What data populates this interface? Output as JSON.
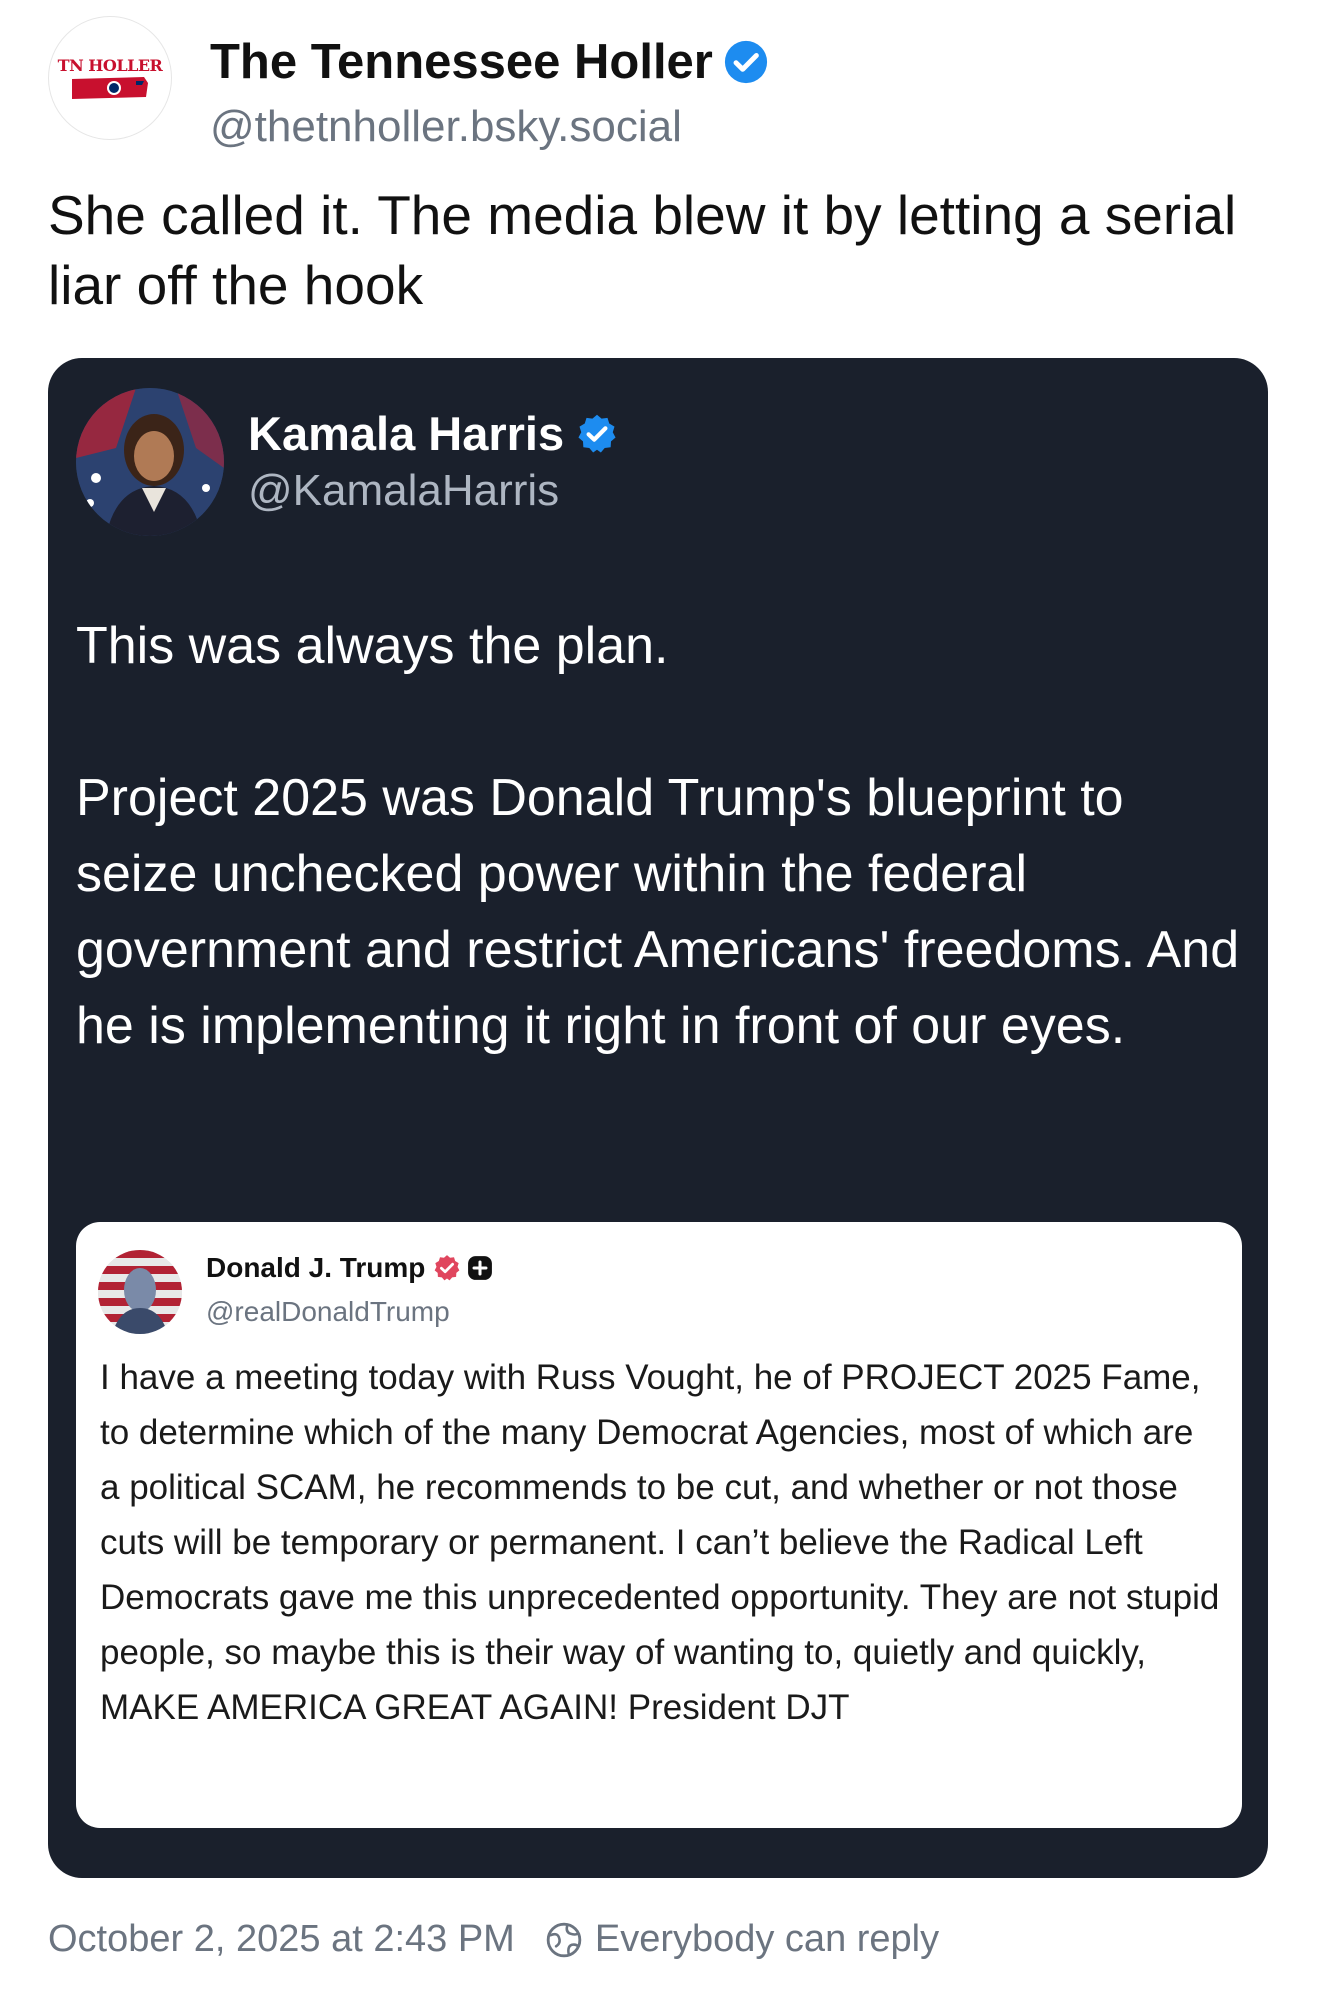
{
  "account": {
    "logo_text": "TN HOLLER",
    "display_name": "The Tennessee Holler",
    "handle": "@thetnholler.bsky.social"
  },
  "post": {
    "text": "She called it. The media blew it by letting a serial liar off the hook"
  },
  "quoted_post": {
    "display_name": "Kamala Harris",
    "handle": "@KamalaHarris",
    "text": "This was always the plan.\n\nProject 2025 was Donald Trump's blueprint to seize unchecked power within the federal government and restrict Americans' freedoms. And he is implementing it right in front of our eyes.",
    "embedded": {
      "display_name": "Donald J. Trump",
      "handle": "@realDonaldTrump",
      "text": "I have a meeting today with Russ Vought, he of PROJECT 2025 Fame,  to determine which of the many Democrat Agencies, most of which are a political SCAM, he recommends to be cut, and whether or not those cuts will be temporary or permanent. I can’t believe the Radical Left Democrats gave me this unprecedented opportunity. They are not stupid people, so maybe this is their way of wanting to, quietly and quickly, MAKE AMERICA GREAT AGAIN! President DJT"
    }
  },
  "footer": {
    "timestamp": "October 2, 2025 at 2:43 PM",
    "reply_setting": "Everybody can reply"
  },
  "icons": {
    "verified": "verified-badge-icon",
    "reply_setting": "reply-setting-icon"
  },
  "colors": {
    "verified_blue": "#1d8cf0",
    "card_background": "#1a202c",
    "truth_badge": "#e0465e"
  }
}
